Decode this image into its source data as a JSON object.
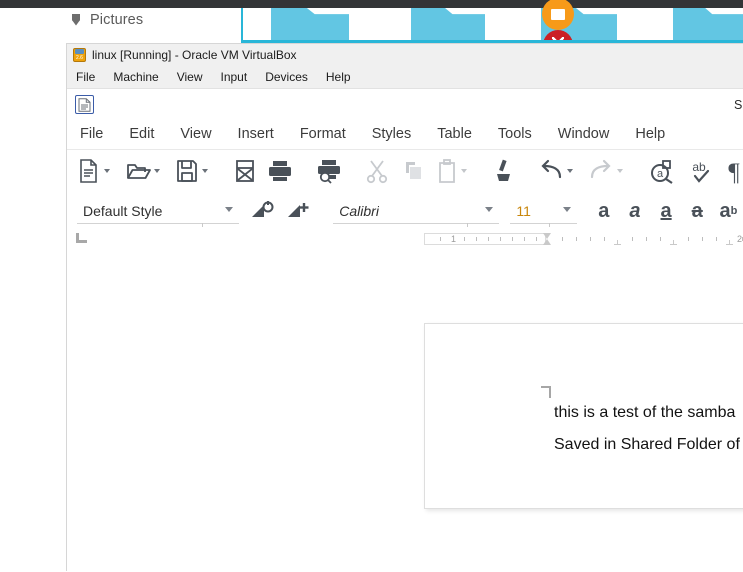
{
  "host": {
    "file_manager": {
      "sidebar_item_label": "Pictures",
      "sidebar_icon": "folder-shape-icon",
      "accent_color": "#29b6d8",
      "folder_color": "#62c6e3",
      "badges": [
        {
          "name": "upload-badge",
          "color": "#f79a19",
          "glyph": ""
        },
        {
          "name": "error-badge",
          "color": "#cb2026",
          "glyph": "✕"
        }
      ]
    },
    "topbar_color": "#333537"
  },
  "virtualbox": {
    "title": "linux [Running] - Oracle VM VirtualBox",
    "icon": "virtualbox-icon",
    "icon_text": "2.6",
    "menu": [
      {
        "label": "File"
      },
      {
        "label": "Machine"
      },
      {
        "label": "View"
      },
      {
        "label": "Input"
      },
      {
        "label": "Devices"
      },
      {
        "label": "Help"
      }
    ]
  },
  "writer": {
    "doc_icon": "writer-document-icon",
    "title_right_fragment": "S",
    "menu": [
      {
        "label": "File"
      },
      {
        "label": "Edit"
      },
      {
        "label": "View"
      },
      {
        "label": "Insert"
      },
      {
        "label": "Format"
      },
      {
        "label": "Styles"
      },
      {
        "label": "Table"
      },
      {
        "label": "Tools"
      },
      {
        "label": "Window"
      },
      {
        "label": "Help"
      }
    ],
    "toolbar": [
      {
        "name": "new-document-button",
        "icon": "new-document-icon",
        "enabled": true,
        "caret": true
      },
      {
        "name": "open-document-button",
        "icon": "open-folder-icon",
        "enabled": true,
        "caret": true
      },
      {
        "name": "save-document-button",
        "icon": "save-floppy-icon",
        "enabled": true,
        "caret": true
      },
      {
        "name": "export-pdf-button",
        "icon": "export-pdf-icon",
        "enabled": true,
        "caret": false
      },
      {
        "name": "print-button",
        "icon": "printer-icon",
        "enabled": true,
        "caret": false
      },
      {
        "name": "print-preview-button",
        "icon": "print-preview-icon",
        "enabled": true,
        "caret": false
      },
      {
        "name": "cut-button",
        "icon": "scissors-icon",
        "enabled": false,
        "caret": false
      },
      {
        "name": "copy-button",
        "icon": "copy-icon",
        "enabled": false,
        "caret": false
      },
      {
        "name": "paste-button",
        "icon": "clipboard-icon",
        "enabled": false,
        "caret": true
      },
      {
        "name": "clone-formatting-button",
        "icon": "paintbrush-icon",
        "enabled": true,
        "caret": false
      },
      {
        "name": "undo-button",
        "icon": "undo-arrow-icon",
        "enabled": true,
        "caret": true
      },
      {
        "name": "redo-button",
        "icon": "redo-arrow-icon",
        "enabled": false,
        "caret": true
      },
      {
        "name": "find-replace-button",
        "icon": "find-replace-icon",
        "enabled": true,
        "caret": false
      },
      {
        "name": "spelling-button",
        "icon": "spellcheck-icon",
        "enabled": true,
        "caret": false
      },
      {
        "name": "formatting-marks-button",
        "icon": "pilcrow-icon",
        "enabled": true,
        "caret": false
      }
    ],
    "formatting": {
      "paragraph_style": "Default Style",
      "update_style_icon": "update-selected-style-icon",
      "new_style_icon": "new-style-from-selection-icon",
      "font_name": "Calibri",
      "font_size": "11",
      "bold_label": "a",
      "italic_label": "a",
      "underline_label": "a",
      "strikethrough_label": "a",
      "superscript_label": "a",
      "superscript_sup": "b"
    },
    "ruler": {
      "numbers": [
        "1",
        "2"
      ],
      "unit": "inch"
    },
    "document": {
      "lines": [
        "this is a test of the samba",
        "Saved in Shared Folder of"
      ]
    }
  }
}
